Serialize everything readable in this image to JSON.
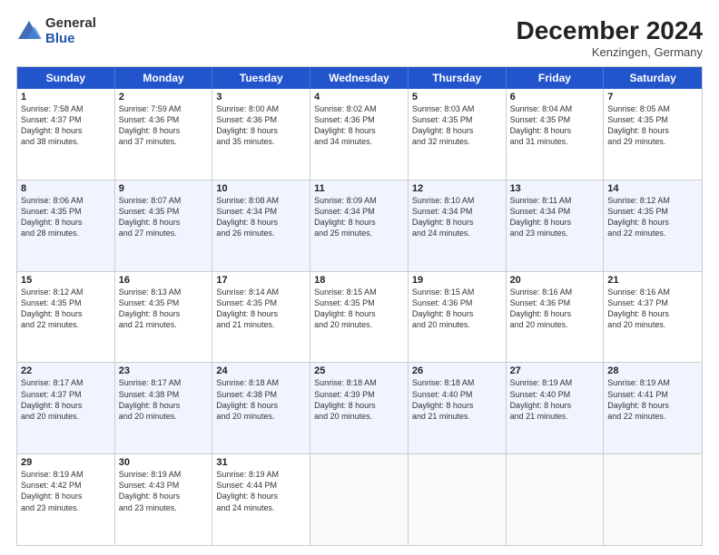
{
  "header": {
    "logo_general": "General",
    "logo_blue": "Blue",
    "month_title": "December 2024",
    "location": "Kenzingen, Germany"
  },
  "days_of_week": [
    "Sunday",
    "Monday",
    "Tuesday",
    "Wednesday",
    "Thursday",
    "Friday",
    "Saturday"
  ],
  "rows": [
    [
      {
        "day": "1",
        "lines": [
          "Sunrise: 7:58 AM",
          "Sunset: 4:37 PM",
          "Daylight: 8 hours",
          "and 38 minutes."
        ]
      },
      {
        "day": "2",
        "lines": [
          "Sunrise: 7:59 AM",
          "Sunset: 4:36 PM",
          "Daylight: 8 hours",
          "and 37 minutes."
        ]
      },
      {
        "day": "3",
        "lines": [
          "Sunrise: 8:00 AM",
          "Sunset: 4:36 PM",
          "Daylight: 8 hours",
          "and 35 minutes."
        ]
      },
      {
        "day": "4",
        "lines": [
          "Sunrise: 8:02 AM",
          "Sunset: 4:36 PM",
          "Daylight: 8 hours",
          "and 34 minutes."
        ]
      },
      {
        "day": "5",
        "lines": [
          "Sunrise: 8:03 AM",
          "Sunset: 4:35 PM",
          "Daylight: 8 hours",
          "and 32 minutes."
        ]
      },
      {
        "day": "6",
        "lines": [
          "Sunrise: 8:04 AM",
          "Sunset: 4:35 PM",
          "Daylight: 8 hours",
          "and 31 minutes."
        ]
      },
      {
        "day": "7",
        "lines": [
          "Sunrise: 8:05 AM",
          "Sunset: 4:35 PM",
          "Daylight: 8 hours",
          "and 29 minutes."
        ]
      }
    ],
    [
      {
        "day": "8",
        "lines": [
          "Sunrise: 8:06 AM",
          "Sunset: 4:35 PM",
          "Daylight: 8 hours",
          "and 28 minutes."
        ]
      },
      {
        "day": "9",
        "lines": [
          "Sunrise: 8:07 AM",
          "Sunset: 4:35 PM",
          "Daylight: 8 hours",
          "and 27 minutes."
        ]
      },
      {
        "day": "10",
        "lines": [
          "Sunrise: 8:08 AM",
          "Sunset: 4:34 PM",
          "Daylight: 8 hours",
          "and 26 minutes."
        ]
      },
      {
        "day": "11",
        "lines": [
          "Sunrise: 8:09 AM",
          "Sunset: 4:34 PM",
          "Daylight: 8 hours",
          "and 25 minutes."
        ]
      },
      {
        "day": "12",
        "lines": [
          "Sunrise: 8:10 AM",
          "Sunset: 4:34 PM",
          "Daylight: 8 hours",
          "and 24 minutes."
        ]
      },
      {
        "day": "13",
        "lines": [
          "Sunrise: 8:11 AM",
          "Sunset: 4:34 PM",
          "Daylight: 8 hours",
          "and 23 minutes."
        ]
      },
      {
        "day": "14",
        "lines": [
          "Sunrise: 8:12 AM",
          "Sunset: 4:35 PM",
          "Daylight: 8 hours",
          "and 22 minutes."
        ]
      }
    ],
    [
      {
        "day": "15",
        "lines": [
          "Sunrise: 8:12 AM",
          "Sunset: 4:35 PM",
          "Daylight: 8 hours",
          "and 22 minutes."
        ]
      },
      {
        "day": "16",
        "lines": [
          "Sunrise: 8:13 AM",
          "Sunset: 4:35 PM",
          "Daylight: 8 hours",
          "and 21 minutes."
        ]
      },
      {
        "day": "17",
        "lines": [
          "Sunrise: 8:14 AM",
          "Sunset: 4:35 PM",
          "Daylight: 8 hours",
          "and 21 minutes."
        ]
      },
      {
        "day": "18",
        "lines": [
          "Sunrise: 8:15 AM",
          "Sunset: 4:35 PM",
          "Daylight: 8 hours",
          "and 20 minutes."
        ]
      },
      {
        "day": "19",
        "lines": [
          "Sunrise: 8:15 AM",
          "Sunset: 4:36 PM",
          "Daylight: 8 hours",
          "and 20 minutes."
        ]
      },
      {
        "day": "20",
        "lines": [
          "Sunrise: 8:16 AM",
          "Sunset: 4:36 PM",
          "Daylight: 8 hours",
          "and 20 minutes."
        ]
      },
      {
        "day": "21",
        "lines": [
          "Sunrise: 8:16 AM",
          "Sunset: 4:37 PM",
          "Daylight: 8 hours",
          "and 20 minutes."
        ]
      }
    ],
    [
      {
        "day": "22",
        "lines": [
          "Sunrise: 8:17 AM",
          "Sunset: 4:37 PM",
          "Daylight: 8 hours",
          "and 20 minutes."
        ]
      },
      {
        "day": "23",
        "lines": [
          "Sunrise: 8:17 AM",
          "Sunset: 4:38 PM",
          "Daylight: 8 hours",
          "and 20 minutes."
        ]
      },
      {
        "day": "24",
        "lines": [
          "Sunrise: 8:18 AM",
          "Sunset: 4:38 PM",
          "Daylight: 8 hours",
          "and 20 minutes."
        ]
      },
      {
        "day": "25",
        "lines": [
          "Sunrise: 8:18 AM",
          "Sunset: 4:39 PM",
          "Daylight: 8 hours",
          "and 20 minutes."
        ]
      },
      {
        "day": "26",
        "lines": [
          "Sunrise: 8:18 AM",
          "Sunset: 4:40 PM",
          "Daylight: 8 hours",
          "and 21 minutes."
        ]
      },
      {
        "day": "27",
        "lines": [
          "Sunrise: 8:19 AM",
          "Sunset: 4:40 PM",
          "Daylight: 8 hours",
          "and 21 minutes."
        ]
      },
      {
        "day": "28",
        "lines": [
          "Sunrise: 8:19 AM",
          "Sunset: 4:41 PM",
          "Daylight: 8 hours",
          "and 22 minutes."
        ]
      }
    ],
    [
      {
        "day": "29",
        "lines": [
          "Sunrise: 8:19 AM",
          "Sunset: 4:42 PM",
          "Daylight: 8 hours",
          "and 23 minutes."
        ]
      },
      {
        "day": "30",
        "lines": [
          "Sunrise: 8:19 AM",
          "Sunset: 4:43 PM",
          "Daylight: 8 hours",
          "and 23 minutes."
        ]
      },
      {
        "day": "31",
        "lines": [
          "Sunrise: 8:19 AM",
          "Sunset: 4:44 PM",
          "Daylight: 8 hours",
          "and 24 minutes."
        ]
      },
      {
        "day": "",
        "lines": []
      },
      {
        "day": "",
        "lines": []
      },
      {
        "day": "",
        "lines": []
      },
      {
        "day": "",
        "lines": []
      }
    ]
  ]
}
